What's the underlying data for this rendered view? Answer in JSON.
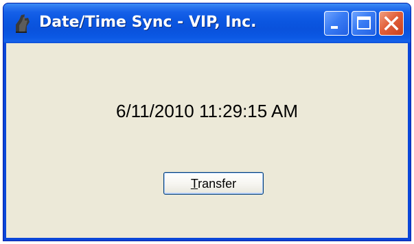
{
  "window": {
    "title": "Date/Time Sync - VIP, Inc.",
    "icon": "app-logo-icon"
  },
  "titlebar_buttons": {
    "minimize_icon": "minimize-icon",
    "maximize_icon": "maximize-icon",
    "close_icon": "close-icon"
  },
  "content": {
    "datetime": "6/11/2010 11:29:15 AM",
    "transfer_button": {
      "mnemonic": "T",
      "rest": "ransfer"
    }
  },
  "colors": {
    "titlebar": "#0a52dc",
    "client_bg": "#ece9d8",
    "close_button": "#e2603a",
    "title_text": "#ffffff"
  }
}
